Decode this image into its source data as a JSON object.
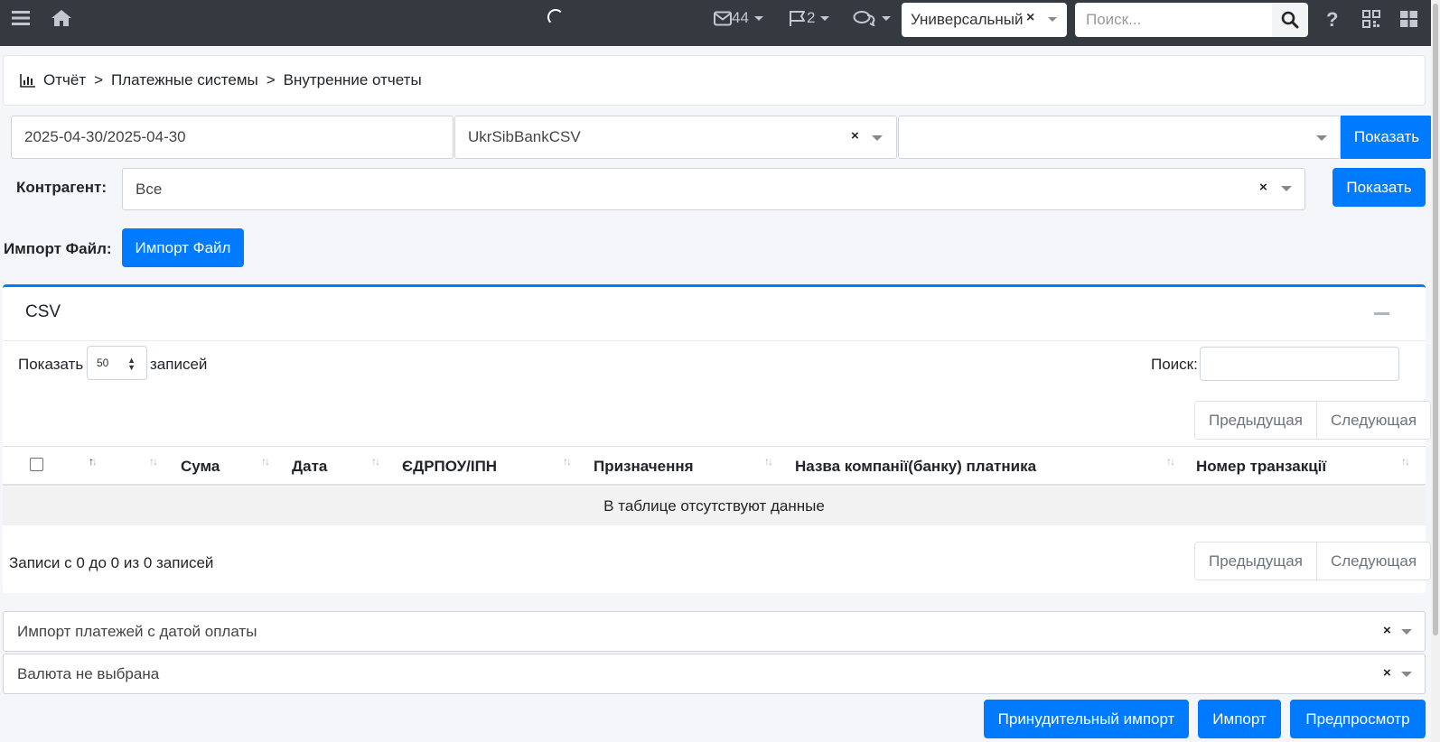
{
  "navbar": {
    "mail_count": "44",
    "flag_count": "2",
    "mode_select": "Универсальный",
    "search_placeholder": "Поиск...",
    "icons": [
      "menu-icon",
      "home-icon",
      "loading-spinner-icon",
      "envelope-icon",
      "flag-icon",
      "chat-icon",
      "search-icon",
      "help-icon",
      "qr-code-icon",
      "grid-icon"
    ]
  },
  "breadcrumb": {
    "items": [
      "Отчёт",
      "Платежные системы",
      "Внутренние отчеты"
    ],
    "separator": ">"
  },
  "filters": {
    "date_range": "2025-04-30/2025-04-30",
    "bank_select": "UkrSibBankCSV",
    "third_select": "",
    "show_button": "Показать",
    "contractor_label": "Контрагент:",
    "contractor_value": "Все",
    "contractor_show_button": "Показать",
    "import_label": "Импорт Файл:",
    "import_button": "Импорт Файл"
  },
  "csv_card": {
    "title": "CSV",
    "length_prefix": "Показать",
    "length_value": "50",
    "length_suffix": "записей",
    "search_label": "Поиск:",
    "prev_label": "Предыдущая",
    "next_label": "Следующая",
    "columns": [
      "Сума",
      "Дата",
      "ЄДРПОУ/ІПН",
      "Призначення",
      "Назва компанії(банку) платника",
      "Номер транзакції"
    ],
    "empty_message": "В таблице отсутствуют данные",
    "info": "Записи с 0 до 0 из 0 записей"
  },
  "bottom": {
    "payment_date_select": "Импорт платежей с датой оплаты",
    "currency_select": "Валюта не выбрана",
    "force_import_button": "Принудительный импорт",
    "import_button": "Импорт",
    "preview_button": "Предпросмотр"
  },
  "colors": {
    "navbar": "#343a40",
    "primary": "#007bff",
    "background": "#f4f6f9"
  }
}
